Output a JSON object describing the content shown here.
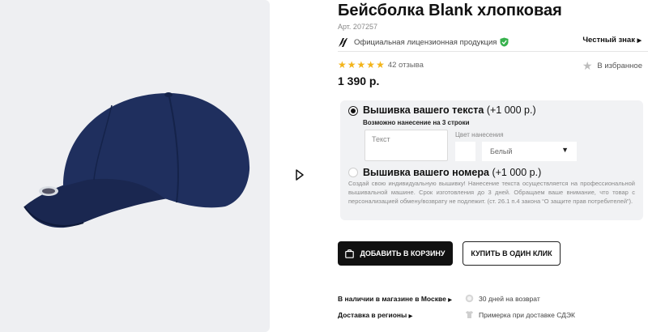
{
  "product": {
    "title": "Бейсболка Blank хлопковая",
    "sku": "Арт. 207257",
    "license_text": "Официальная лицензионная продукция",
    "chestny_znak": "Честный знак",
    "stars": 5,
    "reviews": "42 отзыва",
    "favorite": "В избранное",
    "price": "1 390 р."
  },
  "customization": {
    "option1_title": "Вышивка вашего текста",
    "option1_price": "(+1 000 р.)",
    "option1_sub": "Возможно нанесение на 3 строки",
    "text_placeholder": "Текст",
    "color_label": "Цвет нанесения",
    "color_value": "Белый",
    "option2_title": "Вышивка вашего номера",
    "option2_price": "(+1 000 р.)",
    "note": "Создай свою индивидуальную вышивку! Нанесение текста осуществляется на профессиональной вышивальной машине. Срок изготовления до 3 дней. Обращаем ваше внимание, что товар с персонализацией обмену/возврату не подлежит. (ст. 26.1 п.4 закона “О защите прав потребителей”)."
  },
  "actions": {
    "add_to_cart": "ДОБАВИТЬ В КОРЗИНУ",
    "one_click": "КУПИТЬ В ОДИН КЛИК"
  },
  "delivery": {
    "in_store": "В наличии в магазине в Москве",
    "regions": "Доставка в регионы",
    "returns": "30 дней на возврат",
    "try_on": "Примерка при доставке СДЭК"
  },
  "colors": {
    "accent": "#111111",
    "star": "#f3b41a",
    "shield": "#37b24d",
    "cap": "#1b2a55"
  }
}
